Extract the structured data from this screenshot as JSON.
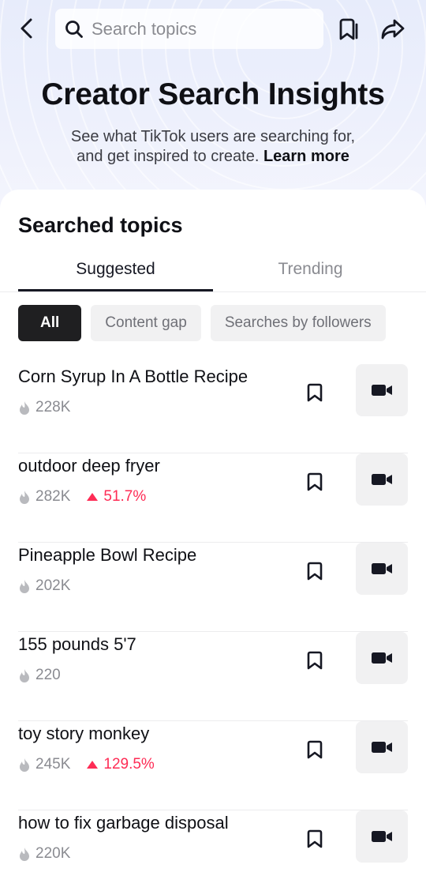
{
  "header": {
    "search_placeholder": "Search topics",
    "title": "Creator Search Insights",
    "subtitle_line1": "See what TikTok users are searching for,",
    "subtitle_line2": "and get inspired to create.",
    "learn_more": "Learn more",
    "icons": [
      "back-arrow-icon",
      "search-icon",
      "bookmarks-icon",
      "share-icon"
    ]
  },
  "section": {
    "title": "Searched topics",
    "tabs": [
      {
        "label": "Suggested",
        "active": true
      },
      {
        "label": "Trending",
        "active": false
      }
    ],
    "chips": [
      {
        "label": "All",
        "active": true
      },
      {
        "label": "Content gap",
        "active": false
      },
      {
        "label": "Searches by followers",
        "active": false
      }
    ]
  },
  "topics": [
    {
      "title": "Corn Syrup In A Bottle Recipe",
      "count": "228K",
      "trend": ""
    },
    {
      "title": "outdoor deep fryer",
      "count": "282K",
      "trend": "51.7%"
    },
    {
      "title": "Pineapple Bowl Recipe",
      "count": "202K",
      "trend": ""
    },
    {
      "title": "155 pounds 5'7",
      "count": "220",
      "trend": ""
    },
    {
      "title": "toy story monkey",
      "count": "245K",
      "trend": "129.5%"
    },
    {
      "title": "how to fix garbage disposal",
      "count": "220K",
      "trend": ""
    }
  ],
  "colors": {
    "trend_up": "#fe2c55",
    "chip_active": "#1f1f21",
    "text_primary": "#161823",
    "text_secondary": "#8a8b91"
  }
}
